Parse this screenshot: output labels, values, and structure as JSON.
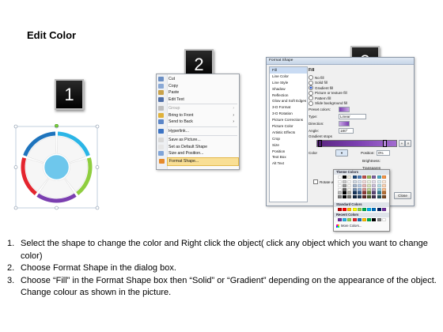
{
  "title": "Edit Color",
  "badges": [
    "1",
    "2",
    "3"
  ],
  "colors": {
    "ring": [
      "#2bb5e6",
      "#8fce3f",
      "#7b3fb0",
      "#e4252e",
      "#1e74bd"
    ],
    "center": "#6ec7ec",
    "menu_highlight": "#f9df95"
  },
  "context_menu": {
    "items": [
      {
        "label": "Cut",
        "icon": "scissors-icon"
      },
      {
        "label": "Copy",
        "icon": "copy-icon"
      },
      {
        "label": "Paste",
        "icon": "paste-icon"
      },
      {
        "label": "Edit Text",
        "icon": "text-icon"
      },
      {
        "label": "Group",
        "icon": "group-icon"
      },
      {
        "label": "Bring to Front",
        "icon": "bring-front-icon"
      },
      {
        "label": "Send to Back",
        "icon": "send-back-icon"
      },
      {
        "label": "Hyperlink...",
        "icon": "hyperlink-icon"
      },
      {
        "label": "Save as Picture...",
        "icon": "picture-icon"
      },
      {
        "label": "Set as Default Shape",
        "icon": "default-shape-icon"
      },
      {
        "label": "Size and Position...",
        "icon": "size-icon"
      },
      {
        "label": "Format Shape...",
        "icon": "format-shape-icon"
      }
    ]
  },
  "dialog": {
    "title": "Format Shape",
    "nav": [
      "Fill",
      "Line Color",
      "Line Style",
      "Shadow",
      "Reflection",
      "Glow and Soft Edges",
      "3-D Format",
      "3-D Rotation",
      "Picture Corrections",
      "Picture Color",
      "Artistic Effects",
      "Crop",
      "Size",
      "Position",
      "Text Box",
      "Alt Text"
    ],
    "fill_heading": "Fill",
    "fill_options": [
      "No fill",
      "Solid fill",
      "Gradient fill",
      "Picture or texture fill",
      "Pattern fill",
      "Slide background fill"
    ],
    "preset_label": "Preset colors:",
    "type_label": "Type:",
    "type_value": "Linear",
    "direction_label": "Direction:",
    "angle_label": "Angle:",
    "angle_value": "180°",
    "stops_label": "Gradient stops",
    "color_label": "Color",
    "position_label": "Position:",
    "position_value": "0%",
    "brightness_label": "Brightness:",
    "transparency_label": "Transparen",
    "rotate_label": "Rotate w",
    "close_label": "Close"
  },
  "palette": {
    "theme_header": "Theme Colors",
    "standard_header": "Standard Colors",
    "recent_header": "Recent Colors",
    "more_label": "More Colors...",
    "theme_top": [
      "#ffffff",
      "#000000",
      "#eeece1",
      "#1f497d",
      "#4f81bd",
      "#c0504d",
      "#9bbb59",
      "#8064a2",
      "#4bacc6",
      "#f79646"
    ],
    "standard": [
      "#c00000",
      "#ff0000",
      "#ffc000",
      "#ffff00",
      "#92d050",
      "#00b050",
      "#00b0f0",
      "#0070c0",
      "#002060",
      "#7030a0"
    ],
    "recent": [
      "#7030a0",
      "#2bb5e6",
      "#92d050",
      "#e4252e",
      "#1e74bd",
      "#ffc000",
      "#00b050",
      "#000000",
      "#808080",
      "#ffffff"
    ]
  },
  "instructions": [
    {
      "num": "1.",
      "text": "Select the shape to change the color and Right click the object( click any object which you want to change color)"
    },
    {
      "num": "2.",
      "text": "Choose Format Shape in the dialog box."
    },
    {
      "num": "3.",
      "text": "Choose “Fill” in the Format Shape box then “Solid” or “Gradient” depending on the appearance of the object. Change colour as shown in the picture."
    }
  ]
}
